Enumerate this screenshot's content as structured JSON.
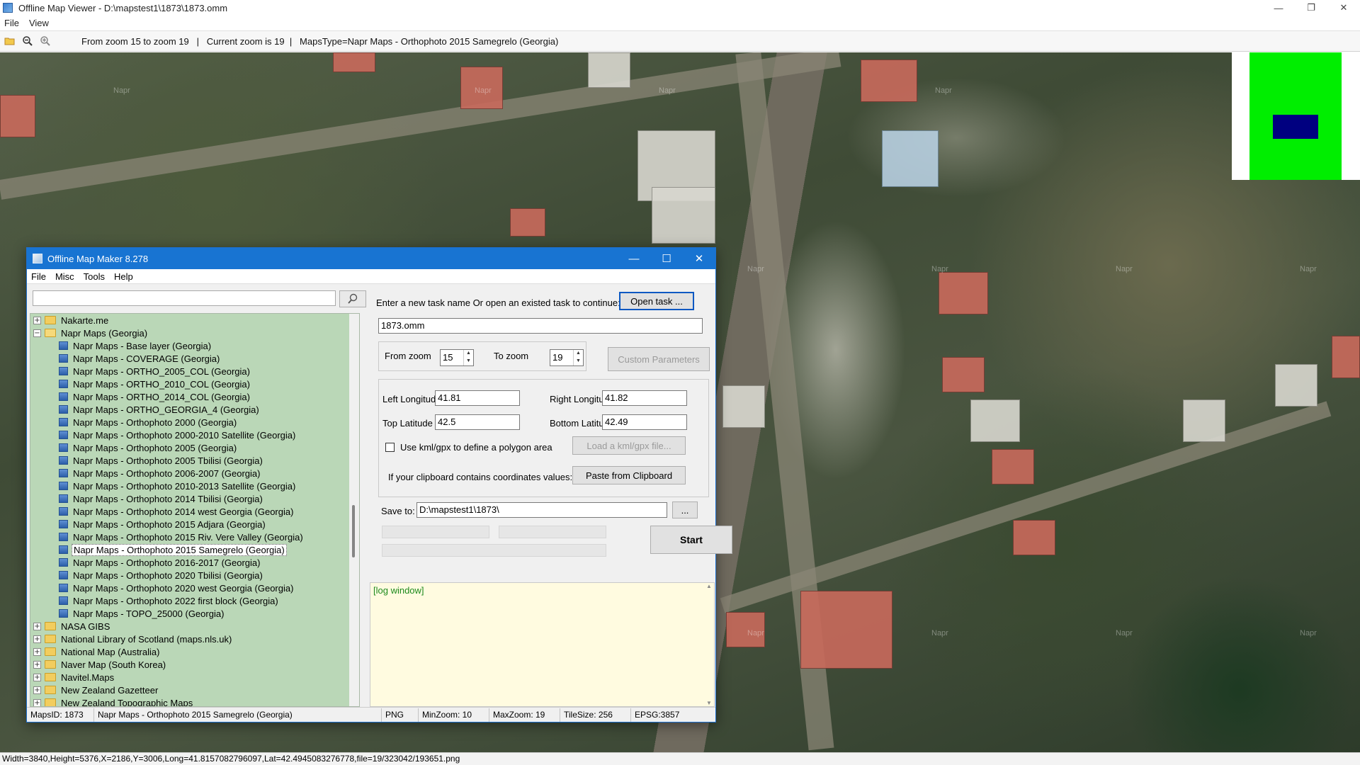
{
  "viewer": {
    "title": "Offline Map Viewer - D:\\mapstest1\\1873\\1873.omm",
    "menu": [
      "File",
      "View"
    ],
    "toolbar_info": "From zoom 15 to zoom 19   |   Current zoom is 19  |   MapsType=Napr Maps - Orthophoto 2015 Samegrelo (Georgia)",
    "status": "Width=3840,Height=5376,X=2186,Y=3006,Long=41.8157082796097,Lat=42.4945083276778,file=19/323042/193651.png",
    "watermark": "Napr"
  },
  "dialog": {
    "title": "Offline Map Maker 8.278",
    "menu": [
      "File",
      "Misc",
      "Tools",
      "Help"
    ],
    "search_value": "",
    "tree": [
      {
        "label": "Nakarte.me",
        "type": "folder",
        "expanded": false
      },
      {
        "label": "Napr Maps (Georgia)",
        "type": "folder",
        "expanded": true
      },
      {
        "label": "Napr Maps - Base layer (Georgia)",
        "type": "map"
      },
      {
        "label": "Napr Maps - COVERAGE (Georgia)",
        "type": "map"
      },
      {
        "label": "Napr Maps - ORTHO_2005_COL (Georgia)",
        "type": "map"
      },
      {
        "label": "Napr Maps - ORTHO_2010_COL (Georgia)",
        "type": "map"
      },
      {
        "label": "Napr Maps - ORTHO_2014_COL (Georgia)",
        "type": "map"
      },
      {
        "label": "Napr Maps - ORTHO_GEORGIA_4 (Georgia)",
        "type": "map"
      },
      {
        "label": "Napr Maps - Orthophoto 2000 (Georgia)",
        "type": "map"
      },
      {
        "label": "Napr Maps - Orthophoto 2000-2010 Satellite (Georgia)",
        "type": "map"
      },
      {
        "label": "Napr Maps - Orthophoto 2005 (Georgia)",
        "type": "map"
      },
      {
        "label": "Napr Maps - Orthophoto 2005 Tbilisi (Georgia)",
        "type": "map"
      },
      {
        "label": "Napr Maps - Orthophoto 2006-2007 (Georgia)",
        "type": "map"
      },
      {
        "label": "Napr Maps - Orthophoto 2010-2013 Satellite (Georgia)",
        "type": "map"
      },
      {
        "label": "Napr Maps - Orthophoto 2014 Tbilisi (Georgia)",
        "type": "map"
      },
      {
        "label": "Napr Maps - Orthophoto 2014 west Georgia (Georgia)",
        "type": "map"
      },
      {
        "label": "Napr Maps - Orthophoto 2015 Adjara (Georgia)",
        "type": "map"
      },
      {
        "label": "Napr Maps - Orthophoto 2015 Riv. Vere Valley (Georgia)",
        "type": "map"
      },
      {
        "label": "Napr Maps - Orthophoto 2015 Samegrelo (Georgia)",
        "type": "map",
        "selected": true
      },
      {
        "label": "Napr Maps - Orthophoto 2016-2017 (Georgia)",
        "type": "map"
      },
      {
        "label": "Napr Maps - Orthophoto 2020 Tbilisi (Georgia)",
        "type": "map"
      },
      {
        "label": "Napr Maps - Orthophoto 2020 west Georgia (Georgia)",
        "type": "map"
      },
      {
        "label": "Napr Maps - Orthophoto 2022 first block (Georgia)",
        "type": "map"
      },
      {
        "label": "Napr Maps - TOPO_25000 (Georgia)",
        "type": "map"
      },
      {
        "label": "NASA GIBS",
        "type": "folder",
        "expanded": false
      },
      {
        "label": "National Library of Scotland (maps.nls.uk)",
        "type": "folder",
        "expanded": false
      },
      {
        "label": "National Map (Australia)",
        "type": "folder",
        "expanded": false
      },
      {
        "label": "Naver Map (South Korea)",
        "type": "folder",
        "expanded": false
      },
      {
        "label": "Navitel.Maps",
        "type": "folder",
        "expanded": false
      },
      {
        "label": "New Zealand Gazetteer",
        "type": "folder",
        "expanded": false
      },
      {
        "label": "New Zealand Topographic Maps",
        "type": "folder",
        "expanded": false
      }
    ],
    "task_prompt": "Enter a new task name Or open an existed task to continue:",
    "open_task_label": "Open task ...",
    "task_name": "1873.omm",
    "from_zoom_label": "From zoom",
    "from_zoom": "15",
    "to_zoom_label": "To zoom",
    "to_zoom": "19",
    "custom_params_label": "Custom Parameters",
    "left_lon_label": "Left Longitude",
    "left_lon": "41.81",
    "right_lon_label": "Right Longitude",
    "right_lon": "41.82",
    "top_lat_label": "Top Latitude",
    "top_lat": "42.5",
    "bottom_lat_label": "Bottom Latitude",
    "bottom_lat": "42.49",
    "kml_label": "Use kml/gpx to define a polygon area",
    "kml_checked": false,
    "load_kml_label": "Load a kml/gpx file...",
    "clipboard_label": "If your clipboard contains coordinates values:",
    "paste_label": "Paste from Clipboard",
    "save_to_label": "Save to:",
    "save_to": "D:\\mapstest1\\1873\\",
    "browse_label": "...",
    "start_label": "Start",
    "log_text": "[log window]",
    "status": {
      "maps_id": "MapsID: 1873",
      "map_name": "Napr Maps - Orthophoto 2015 Samegrelo (Georgia)",
      "format": "PNG",
      "min_zoom": "MinZoom: 10",
      "max_zoom": "MaxZoom: 19",
      "tile_size": "TileSize: 256",
      "epsg": "EPSG:3857"
    }
  },
  "colors": {
    "dialog_title_bar": "#1874d2",
    "tree_background": "#bad7b7",
    "log_background": "#fffbe0",
    "log_text": "#1c8a1c",
    "minimap_green": "#00ee00",
    "minimap_viewport": "#000080"
  }
}
